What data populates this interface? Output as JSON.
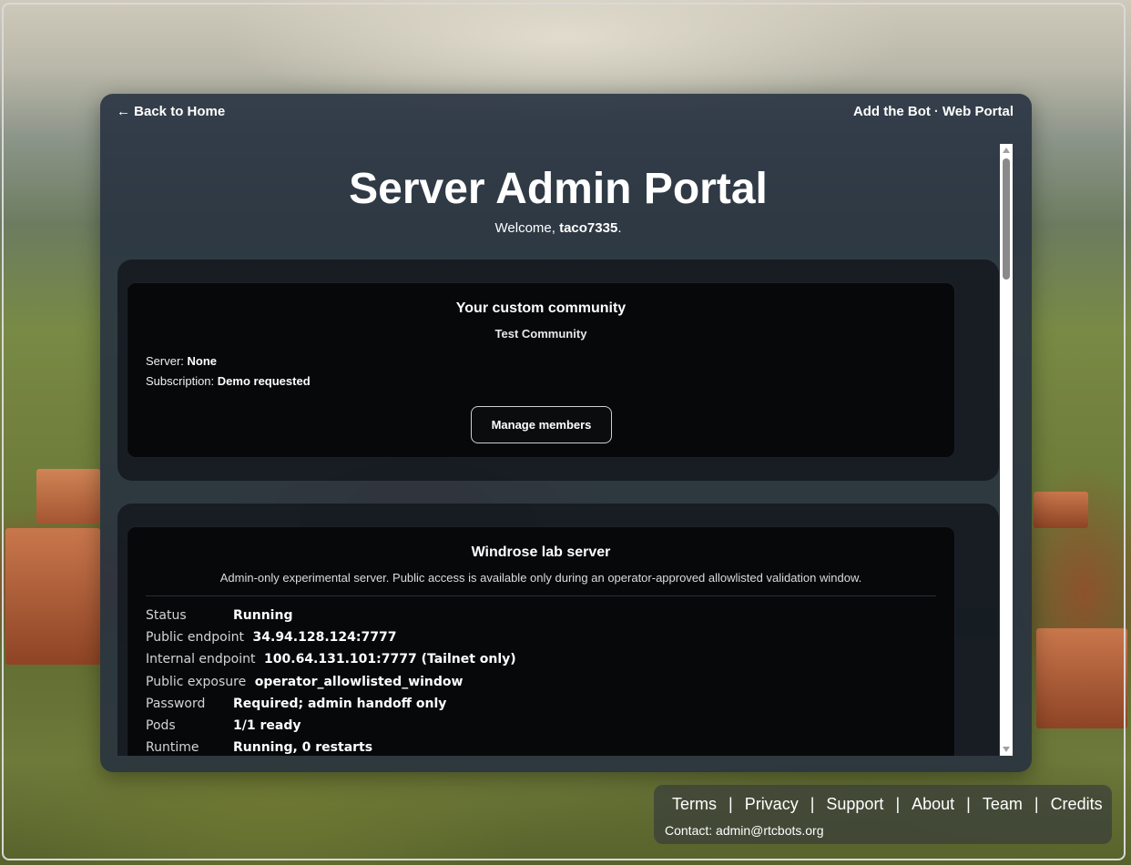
{
  "nav": {
    "back": "← Back to Home",
    "add_bot": "Add the Bot",
    "separator": "·",
    "web_portal": "Web Portal"
  },
  "header": {
    "title": "Server Admin Portal",
    "welcome_prefix": "Welcome, ",
    "username": "taco7335",
    "welcome_suffix": "."
  },
  "community_card": {
    "title": "Your custom community",
    "name": "Test Community",
    "server_label": "Server:",
    "server_value": "None",
    "subscription_label": "Subscription:",
    "subscription_value": "Demo requested",
    "manage_button": "Manage members"
  },
  "server_card": {
    "title": "Windrose lab server",
    "description": "Admin-only experimental server. Public access is available only during an operator-approved allowlisted validation window.",
    "rows": [
      {
        "label": "Status",
        "value": "Running"
      },
      {
        "label": "Public endpoint",
        "value": "34.94.128.124:7777"
      },
      {
        "label": "Internal endpoint",
        "value": "100.64.131.101:7777 (Tailnet only)"
      },
      {
        "label": "Public exposure",
        "value": "operator_allowlisted_window"
      },
      {
        "label": "Password",
        "value": "Required; admin handoff only"
      },
      {
        "label": "Pods",
        "value": "1/1 ready"
      },
      {
        "label": "Runtime",
        "value": "Running, 0 restarts"
      }
    ]
  },
  "footer": {
    "links": [
      "Terms",
      "Privacy",
      "Support",
      "About",
      "Team",
      "Credits"
    ],
    "divider": "|",
    "contact": "Contact: admin@rtcbots.org"
  }
}
